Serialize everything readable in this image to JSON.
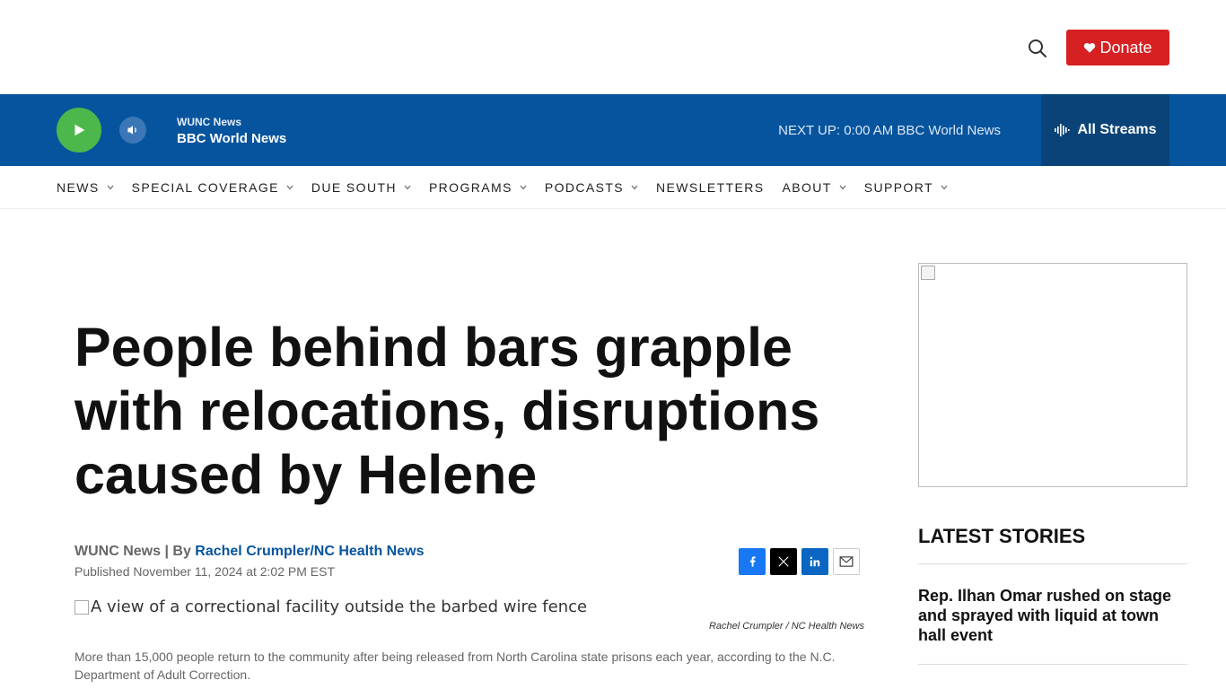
{
  "header": {
    "donate_label": "Donate"
  },
  "player": {
    "station": "WUNC News",
    "program": "BBC World News",
    "next_up": "NEXT UP: 0:00 AM BBC World News",
    "all_streams": "All Streams"
  },
  "nav": {
    "items": [
      {
        "label": "NEWS"
      },
      {
        "label": "SPECIAL COVERAGE"
      },
      {
        "label": "DUE SOUTH"
      },
      {
        "label": "PROGRAMS"
      },
      {
        "label": "PODCASTS"
      },
      {
        "label": "NEWSLETTERS"
      },
      {
        "label": "ABOUT"
      },
      {
        "label": "SUPPORT"
      }
    ]
  },
  "article": {
    "headline": "People behind bars grapple with relocations, disruptions caused by Helene",
    "source": "WUNC News",
    "byline_sep": " | By ",
    "author": "Rachel Crumpler/NC Health News",
    "published": "Published November 11, 2024 at 2:02 PM EST",
    "image_alt": "A view of a correctional facility outside the barbed wire fence",
    "credit_person": "Rachel Crumpler",
    "credit_sep": " / ",
    "credit_org": "NC Health News",
    "body": "More than 15,000 people return to the community after being released from North Carolina state prisons each year, according to the N.C. Department of Adult Correction."
  },
  "sidebar": {
    "latest_title": "LATEST STORIES",
    "stories": [
      {
        "title": "Rep. Ilhan Omar rushed on stage and sprayed with liquid at town hall event"
      }
    ]
  },
  "colors": {
    "brand_blue": "#06549e",
    "donate_red": "#d62021",
    "play_green": "#4cb84b"
  }
}
